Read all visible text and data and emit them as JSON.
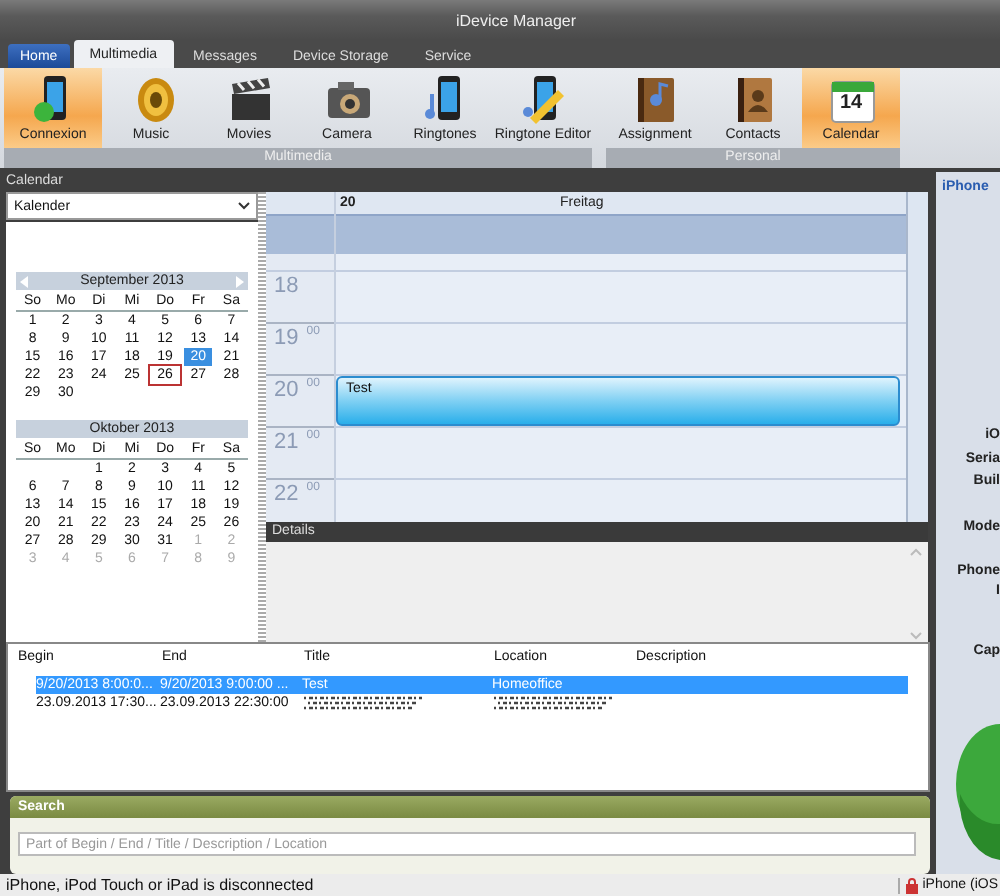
{
  "window": {
    "title": "iDevice Manager"
  },
  "tabs": [
    {
      "label": "Home",
      "kind": "app-menu",
      "selected": false
    },
    {
      "label": "Multimedia",
      "kind": "tab",
      "selected": true
    },
    {
      "label": "Messages",
      "kind": "tab",
      "selected": false
    },
    {
      "label": "Device Storage",
      "kind": "tab",
      "selected": false
    },
    {
      "label": "Service",
      "kind": "tab",
      "selected": false
    }
  ],
  "ribbon_groups": [
    {
      "label": "Multimedia",
      "buttons": [
        {
          "label": "Connexion",
          "selected": true
        },
        {
          "label": "Music",
          "selected": false
        },
        {
          "label": "Movies",
          "selected": false
        },
        {
          "label": "Camera",
          "selected": false
        },
        {
          "label": "Ringtones",
          "selected": false
        },
        {
          "label": "Ringtone Editor",
          "selected": false
        }
      ]
    },
    {
      "label": "Personal",
      "buttons": [
        {
          "label": "Assignment",
          "selected": false
        },
        {
          "label": "Contacts",
          "selected": false
        },
        {
          "label": "Calendar",
          "selected": true,
          "icon_text": "14"
        }
      ]
    }
  ],
  "calendar_panel": {
    "title": "Calendar",
    "dropdown": {
      "value": "Kalender"
    },
    "months": [
      {
        "title": "September 2013",
        "has_nav": true,
        "weekdays": [
          "So",
          "Mo",
          "Di",
          "Mi",
          "Do",
          "Fr",
          "Sa"
        ],
        "weeks": [
          [
            {
              "d": "1",
              "selected": false,
              "today": false,
              "dimmed": false
            },
            {
              "d": "2",
              "selected": false,
              "today": false,
              "dimmed": false
            },
            {
              "d": "3",
              "selected": false,
              "today": false,
              "dimmed": false
            },
            {
              "d": "4",
              "selected": false,
              "today": false,
              "dimmed": false
            },
            {
              "d": "5",
              "selected": false,
              "today": false,
              "dimmed": false
            },
            {
              "d": "6",
              "selected": false,
              "today": false,
              "dimmed": false
            },
            {
              "d": "7",
              "selected": false,
              "today": false,
              "dimmed": false
            }
          ],
          [
            {
              "d": "8",
              "selected": false,
              "today": false,
              "dimmed": false
            },
            {
              "d": "9",
              "selected": false,
              "today": false,
              "dimmed": false
            },
            {
              "d": "10",
              "selected": false,
              "today": false,
              "dimmed": false
            },
            {
              "d": "11",
              "selected": false,
              "today": false,
              "dimmed": false
            },
            {
              "d": "12",
              "selected": false,
              "today": false,
              "dimmed": false
            },
            {
              "d": "13",
              "selected": false,
              "today": false,
              "dimmed": false
            },
            {
              "d": "14",
              "selected": false,
              "today": false,
              "dimmed": false
            }
          ],
          [
            {
              "d": "15",
              "selected": false,
              "today": false,
              "dimmed": false
            },
            {
              "d": "16",
              "selected": false,
              "today": false,
              "dimmed": false
            },
            {
              "d": "17",
              "selected": false,
              "today": false,
              "dimmed": false
            },
            {
              "d": "18",
              "selected": false,
              "today": false,
              "dimmed": false
            },
            {
              "d": "19",
              "selected": false,
              "today": false,
              "dimmed": false
            },
            {
              "d": "20",
              "selected": true,
              "today": false,
              "dimmed": false
            },
            {
              "d": "21",
              "selected": false,
              "today": false,
              "dimmed": false
            }
          ],
          [
            {
              "d": "22",
              "selected": false,
              "today": false,
              "dimmed": false
            },
            {
              "d": "23",
              "selected": false,
              "today": false,
              "dimmed": false
            },
            {
              "d": "24",
              "selected": false,
              "today": false,
              "dimmed": false
            },
            {
              "d": "25",
              "selected": false,
              "today": false,
              "dimmed": false
            },
            {
              "d": "26",
              "selected": false,
              "today": true,
              "dimmed": false
            },
            {
              "d": "27",
              "selected": false,
              "today": false,
              "dimmed": false
            },
            {
              "d": "28",
              "selected": false,
              "today": false,
              "dimmed": false
            }
          ],
          [
            {
              "d": "29",
              "selected": false,
              "today": false,
              "dimmed": false
            },
            {
              "d": "30",
              "selected": false,
              "today": false,
              "dimmed": false
            }
          ]
        ]
      },
      {
        "title": "Oktober 2013",
        "has_nav": false,
        "weekdays": [
          "So",
          "Mo",
          "Di",
          "Mi",
          "Do",
          "Fr",
          "Sa"
        ],
        "weeks": [
          [
            {
              "d": "1",
              "selected": false,
              "today": false,
              "dimmed": false
            },
            {
              "d": "2",
              "selected": false,
              "today": false,
              "dimmed": false
            },
            {
              "d": "3",
              "selected": false,
              "today": false,
              "dimmed": false
            },
            {
              "d": "4",
              "selected": false,
              "today": false,
              "dimmed": false
            },
            {
              "d": "5",
              "selected": false,
              "today": false,
              "dimmed": false
            }
          ],
          [
            {
              "d": "6",
              "selected": false,
              "today": false,
              "dimmed": false
            },
            {
              "d": "7",
              "selected": false,
              "today": false,
              "dimmed": false
            },
            {
              "d": "8",
              "selected": false,
              "today": false,
              "dimmed": false
            },
            {
              "d": "9",
              "selected": false,
              "today": false,
              "dimmed": false
            },
            {
              "d": "10",
              "selected": false,
              "today": false,
              "dimmed": false
            },
            {
              "d": "11",
              "selected": false,
              "today": false,
              "dimmed": false
            },
            {
              "d": "12",
              "selected": false,
              "today": false,
              "dimmed": false
            }
          ],
          [
            {
              "d": "13",
              "selected": false,
              "today": false,
              "dimmed": false
            },
            {
              "d": "14",
              "selected": false,
              "today": false,
              "dimmed": false
            },
            {
              "d": "15",
              "selected": false,
              "today": false,
              "dimmed": false
            },
            {
              "d": "16",
              "selected": false,
              "today": false,
              "dimmed": false
            },
            {
              "d": "17",
              "selected": false,
              "today": false,
              "dimmed": false
            },
            {
              "d": "18",
              "selected": false,
              "today": false,
              "dimmed": false
            },
            {
              "d": "19",
              "selected": false,
              "today": false,
              "dimmed": false
            }
          ],
          [
            {
              "d": "20",
              "selected": false,
              "today": false,
              "dimmed": false
            },
            {
              "d": "21",
              "selected": false,
              "today": false,
              "dimmed": false
            },
            {
              "d": "22",
              "selected": false,
              "today": false,
              "dimmed": false
            },
            {
              "d": "23",
              "selected": false,
              "today": false,
              "dimmed": false
            },
            {
              "d": "24",
              "selected": false,
              "today": false,
              "dimmed": false
            },
            {
              "d": "25",
              "selected": false,
              "today": false,
              "dimmed": false
            },
            {
              "d": "26",
              "selected": false,
              "today": false,
              "dimmed": false
            }
          ],
          [
            {
              "d": "27",
              "selected": false,
              "today": false,
              "dimmed": false
            },
            {
              "d": "28",
              "selected": false,
              "today": false,
              "dimmed": false
            },
            {
              "d": "29",
              "selected": false,
              "today": false,
              "dimmed": false
            },
            {
              "d": "30",
              "selected": false,
              "today": false,
              "dimmed": false
            },
            {
              "d": "31",
              "selected": false,
              "today": false,
              "dimmed": false
            },
            {
              "d": "1",
              "selected": false,
              "today": false,
              "dimmed": true
            },
            {
              "d": "2",
              "selected": false,
              "today": false,
              "dimmed": true
            }
          ],
          [
            {
              "d": "3",
              "selected": false,
              "today": false,
              "dimmed": true
            },
            {
              "d": "4",
              "selected": false,
              "today": false,
              "dimmed": true
            },
            {
              "d": "5",
              "selected": false,
              "today": false,
              "dimmed": true
            },
            {
              "d": "6",
              "selected": false,
              "today": false,
              "dimmed": true
            },
            {
              "d": "7",
              "selected": false,
              "today": false,
              "dimmed": true
            },
            {
              "d": "8",
              "selected": false,
              "today": false,
              "dimmed": true
            },
            {
              "d": "9",
              "selected": false,
              "today": false,
              "dimmed": true
            }
          ]
        ]
      }
    ]
  },
  "day_view": {
    "date": "20",
    "weekday": "Freitag",
    "hours": [
      {
        "hour": "18"
      },
      {
        "hour": "19",
        "minutes": "00"
      },
      {
        "hour": "20",
        "minutes": "00",
        "events": [
          {
            "title": "Test"
          }
        ]
      },
      {
        "hour": "21",
        "minutes": "00"
      },
      {
        "hour": "22",
        "minutes": "00"
      }
    ]
  },
  "details": {
    "title": "Details"
  },
  "appointments": {
    "columns": [
      "Begin",
      "End",
      "Title",
      "Location",
      "Description"
    ],
    "rows": [
      {
        "selected": true,
        "cells": [
          {
            "text": "9/20/2013 8:00:0...",
            "redacted": false
          },
          {
            "text": "9/20/2013 9:00:00 ...",
            "redacted": false
          },
          {
            "text": "Test",
            "redacted": false
          },
          {
            "text": "Homeoffice",
            "redacted": false
          }
        ]
      },
      {
        "selected": false,
        "cells": [
          {
            "text": "23.09.2013 17:30...",
            "redacted": false
          },
          {
            "text": "23.09.2013 22:30:00",
            "redacted": false
          },
          {
            "redacted": true
          },
          {
            "redacted": true
          }
        ]
      }
    ]
  },
  "search": {
    "title": "Search",
    "placeholder": "Part of Begin / End / Title / Description / Location"
  },
  "device_panel": {
    "title": "iPhone",
    "labels": [
      "iO",
      "Seria",
      "Buil",
      "Mode",
      "Phone",
      "I",
      "Cap"
    ]
  },
  "status_bar": {
    "message": "iPhone, iPod Touch or iPad is disconnected",
    "device": "iPhone (iOS"
  }
}
